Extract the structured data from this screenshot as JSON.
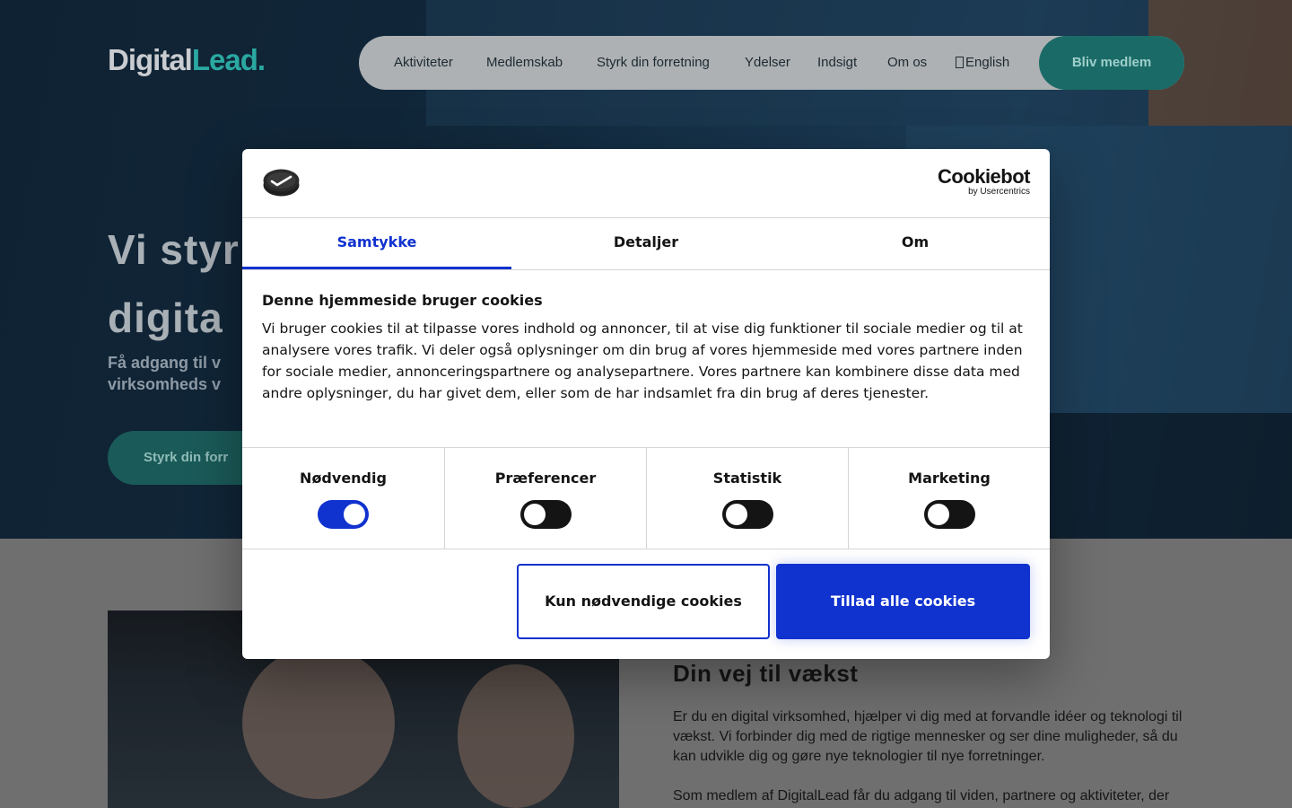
{
  "site": {
    "logo": {
      "part1": "Digital",
      "part2": "Lead."
    },
    "nav": {
      "items": [
        "Aktiviteter",
        "Medlemskab",
        "Styrk din forretning",
        "Ydelser",
        "Indsigt",
        "Om os"
      ],
      "language_icon": "globe-icon",
      "language": "English",
      "cta": "Bliv medlem"
    },
    "hero": {
      "title_line1": "Vi styr",
      "title_line2": "digita",
      "subtitle_line1": "Få adgang til v",
      "subtitle_line2": "virksomheds v",
      "cta": "Styrk din forr"
    },
    "section": {
      "title": "Din vej til vækst",
      "paragraph1": "Er du en digital virksomhed, hjælper vi dig med at forvandle idéer og teknologi til vækst. Vi forbinder dig med de rigtige mennesker og ser dine muligheder, så du kan udvikle dig og gøre nye teknologier til nye forretninger.",
      "paragraph2": "Som medlem af DigitalLead får du adgang til viden, partnere og aktiviteter, der"
    },
    "colors": {
      "accent_teal": "#1a6b67",
      "logo_teal": "#2aa9a1"
    }
  },
  "cookie_dialog": {
    "brand": {
      "name": "Cookiebot",
      "byline": "by Usercentrics",
      "logo_icon": "cookiebot-logo-icon"
    },
    "tabs": [
      {
        "label": "Samtykke",
        "active": true
      },
      {
        "label": "Detaljer",
        "active": false
      },
      {
        "label": "Om",
        "active": false
      }
    ],
    "title": "Denne hjemmeside bruger cookies",
    "text": "Vi bruger cookies til at tilpasse vores indhold og annoncer, til at vise dig funktioner til sociale medier og til at analysere vores trafik. Vi deler også oplysninger om din brug af vores hjemmeside med vores partnere inden for sociale medier, annonceringspartnere og analysepartnere. Vores partnere kan kombinere disse data med andre oplysninger, du har givet dem, eller som de har indsamlet fra din brug af deres tjenester.",
    "toggles": [
      {
        "label": "Nødvendig",
        "on": true
      },
      {
        "label": "Præferencer",
        "on": false
      },
      {
        "label": "Statistik",
        "on": false
      },
      {
        "label": "Marketing",
        "on": false
      }
    ],
    "buttons": {
      "necessary_only": "Kun nødvendige cookies",
      "allow_all": "Tillad alle cookies"
    },
    "colors": {
      "primary": "#1032cf"
    }
  }
}
